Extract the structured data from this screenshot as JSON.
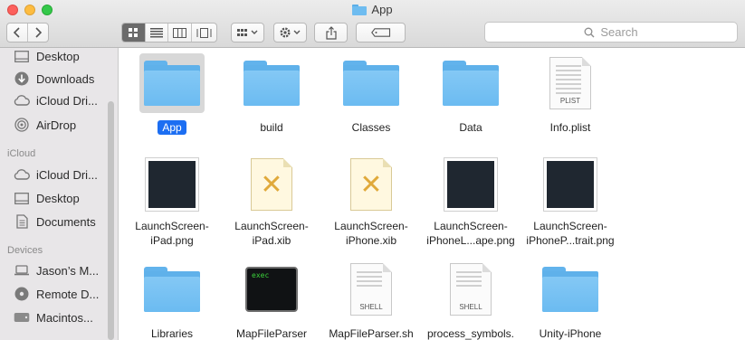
{
  "window": {
    "title": "App",
    "colors": {
      "selection": "#1c6ef2",
      "folder": "#6bbbf1"
    }
  },
  "toolbar": {
    "back_icon": "chevron-left-icon",
    "forward_icon": "chevron-right-icon",
    "view_modes": [
      "icon-view-icon",
      "list-view-icon",
      "column-view-icon",
      "coverflow-view-icon"
    ],
    "active_view": "icon-view-icon",
    "arrange_icon": "arrange-grid-icon",
    "action_icon": "gear-icon",
    "share_icon": "share-icon",
    "tag_icon": "tag-icon",
    "search_placeholder": "Search"
  },
  "sidebar": {
    "favorites": [
      {
        "label": "Desktop",
        "icon": "desktop-icon"
      },
      {
        "label": "Downloads",
        "icon": "downloads-icon"
      },
      {
        "label": "iCloud Dri...",
        "icon": "cloud-icon"
      },
      {
        "label": "AirDrop",
        "icon": "airdrop-icon"
      }
    ],
    "icloud_header": "iCloud",
    "icloud": [
      {
        "label": "iCloud Dri...",
        "icon": "cloud-icon"
      },
      {
        "label": "Desktop",
        "icon": "desktop-icon"
      },
      {
        "label": "Documents",
        "icon": "document-icon"
      }
    ],
    "devices_header": "Devices",
    "devices": [
      {
        "label": "Jason’s M...",
        "icon": "laptop-icon"
      },
      {
        "label": "Remote D...",
        "icon": "disc-icon"
      },
      {
        "label": "Macintos...",
        "icon": "harddisk-icon"
      }
    ]
  },
  "files": [
    {
      "name": "App",
      "type": "folder",
      "selected": true
    },
    {
      "name": "build",
      "type": "folder"
    },
    {
      "name": "Classes",
      "type": "folder"
    },
    {
      "name": "Data",
      "type": "folder"
    },
    {
      "name": "Info.plist",
      "type": "plist",
      "tag": "PLIST"
    },
    {
      "name": "LaunchScreen-iPad.png",
      "line1": "LaunchScreen-",
      "line2": "iPad.png",
      "type": "png"
    },
    {
      "name": "LaunchScreen-iPad.xib",
      "line1": "LaunchScreen-",
      "line2": "iPad.xib",
      "type": "xib"
    },
    {
      "name": "LaunchScreen-iPhone.xib",
      "line1": "LaunchScreen-",
      "line2": "iPhone.xib",
      "type": "xib"
    },
    {
      "name": "LaunchScreen-iPhoneL...ape.png",
      "line1": "LaunchScreen-",
      "line2": "iPhoneL...ape.png",
      "type": "png"
    },
    {
      "name": "LaunchScreen-iPhoneP...trait.png",
      "line1": "LaunchScreen-",
      "line2": "iPhoneP...trait.png",
      "type": "png"
    },
    {
      "name": "Libraries",
      "type": "folder"
    },
    {
      "name": "MapFileParser",
      "type": "exec",
      "tag": "exec"
    },
    {
      "name": "MapFileParser.sh",
      "type": "shell",
      "tag": "SHELL"
    },
    {
      "name": "process_symbols.",
      "type": "shell",
      "tag": "SHELL"
    },
    {
      "name": "Unity-iPhone",
      "type": "folder"
    }
  ]
}
